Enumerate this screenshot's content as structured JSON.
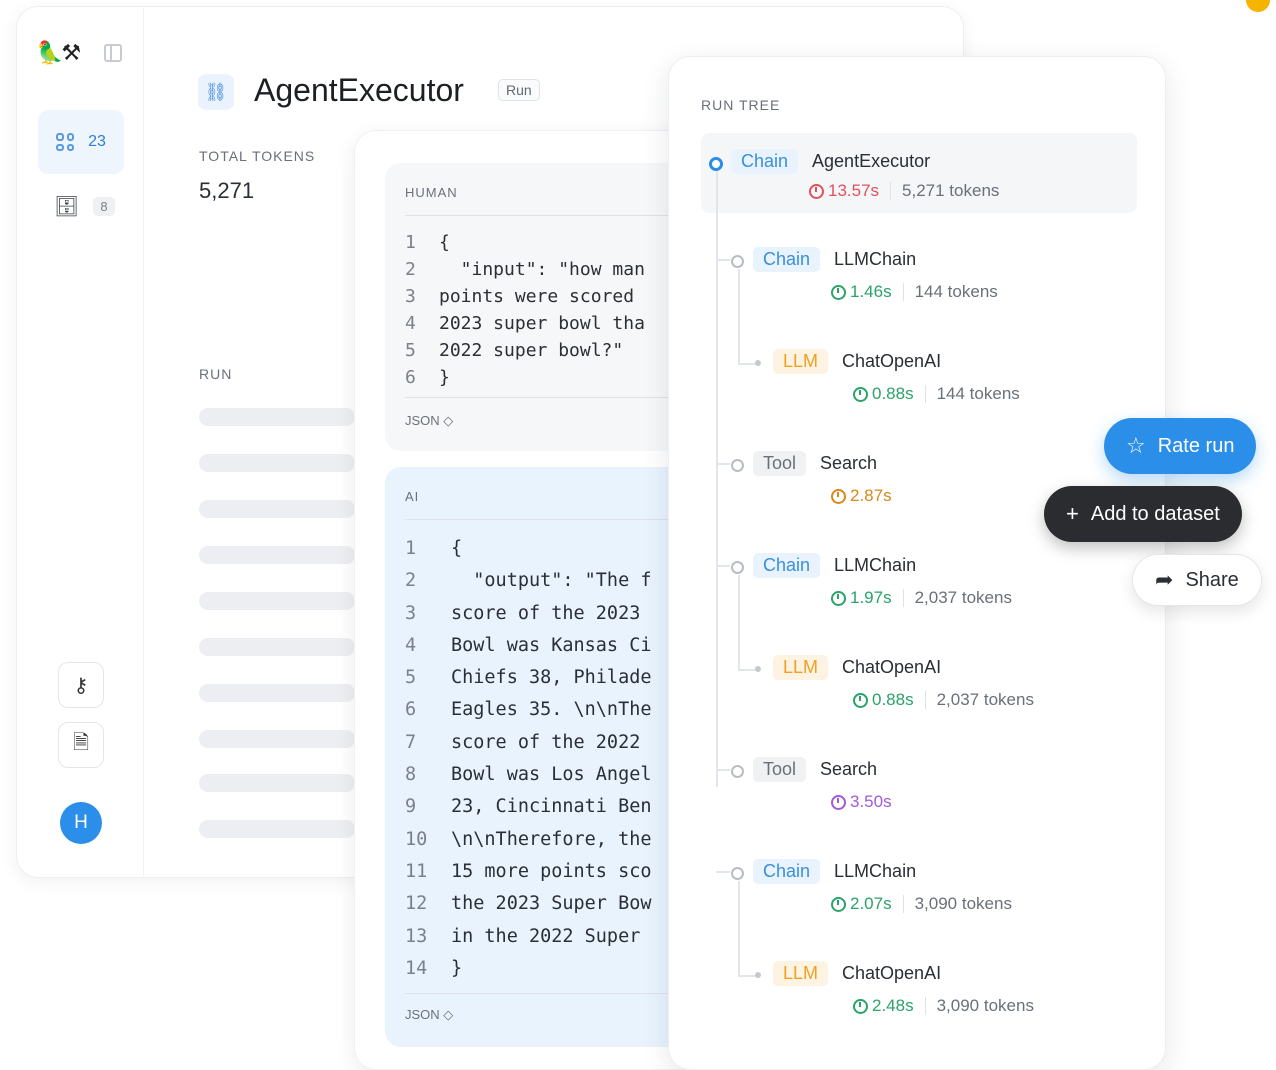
{
  "colors": {
    "accent": "#2b8ee8",
    "chain_tag": "#3a8fdc",
    "llm_tag": "#f0a01e",
    "time_red": "#e0525b",
    "time_green": "#2aa368",
    "time_orange": "#d9881a",
    "time_purple": "#a15ad8"
  },
  "sidebar": {
    "logo": "🦜⚒",
    "nav_active_count": "23",
    "nav_db_count": "8",
    "avatar_initial": "H",
    "icons": [
      "grid-icon",
      "database-icon",
      "key-icon",
      "document-icon",
      "panel-toggle-icon"
    ]
  },
  "header": {
    "title": "AgentExecutor",
    "badge": "Run"
  },
  "summary": {
    "total_tokens_label": "TOTAL TOKENS",
    "total_tokens_value": "5,271",
    "run_label": "RUN"
  },
  "human": {
    "label": "HUMAN",
    "lines": [
      {
        "n": "1",
        "text": "{"
      },
      {
        "n": "2",
        "text": "  \"input\": \"how man"
      },
      {
        "n": "3",
        "text": "points were scored"
      },
      {
        "n": "4",
        "text": "2023 super bowl tha"
      },
      {
        "n": "5",
        "text": "2022 super bowl?\""
      },
      {
        "n": "6",
        "text": "}"
      }
    ],
    "format": "JSON ◇"
  },
  "ai": {
    "label": "AI",
    "lines": [
      {
        "n": "1",
        "text": "{"
      },
      {
        "n": "2",
        "text": "  \"output\": \"The f"
      },
      {
        "n": "3",
        "text": "score of the 2023"
      },
      {
        "n": "4",
        "text": "Bowl was Kansas Ci"
      },
      {
        "n": "5",
        "text": "Chiefs 38, Philade"
      },
      {
        "n": "6",
        "text": "Eagles 35. \\n\\nThe"
      },
      {
        "n": "7",
        "text": "score of the 2022"
      },
      {
        "n": "8",
        "text": "Bowl was Los Angel"
      },
      {
        "n": "9",
        "text": "23, Cincinnati Ben"
      },
      {
        "n": "10",
        "text": "\\n\\nTherefore, the"
      },
      {
        "n": "11",
        "text": "15 more points sco"
      },
      {
        "n": "12",
        "text": "the 2023 Super Bow"
      },
      {
        "n": "13",
        "text": "in the 2022 Super"
      },
      {
        "n": "14",
        "text": "}"
      }
    ],
    "format": "JSON ◇"
  },
  "run_tree": {
    "title": "RUN TREE",
    "nodes": [
      {
        "tag": "Chain",
        "kind": "chain",
        "name": "AgentExecutor",
        "time": "13.57s",
        "time_color": "#e0525b",
        "tokens": "5,271 tokens"
      },
      {
        "tag": "Chain",
        "kind": "chain",
        "name": "LLMChain",
        "time": "1.46s",
        "time_color": "#2aa368",
        "tokens": "144 tokens"
      },
      {
        "tag": "LLM",
        "kind": "llm",
        "name": "ChatOpenAI",
        "time": "0.88s",
        "time_color": "#2aa368",
        "tokens": "144 tokens"
      },
      {
        "tag": "Tool",
        "kind": "tool",
        "name": "Search",
        "time": "2.87s",
        "time_color": "#d9881a",
        "tokens": ""
      },
      {
        "tag": "Chain",
        "kind": "chain",
        "name": "LLMChain",
        "time": "1.97s",
        "time_color": "#2aa368",
        "tokens": "2,037 tokens"
      },
      {
        "tag": "LLM",
        "kind": "llm",
        "name": "ChatOpenAI",
        "time": "0.88s",
        "time_color": "#2aa368",
        "tokens": "2,037 tokens"
      },
      {
        "tag": "Tool",
        "kind": "tool",
        "name": "Search",
        "time": "3.50s",
        "time_color": "#a15ad8",
        "tokens": ""
      },
      {
        "tag": "Chain",
        "kind": "chain",
        "name": "LLMChain",
        "time": "2.07s",
        "time_color": "#2aa368",
        "tokens": "3,090 tokens"
      },
      {
        "tag": "LLM",
        "kind": "llm",
        "name": "ChatOpenAI",
        "time": "2.48s",
        "time_color": "#2aa368",
        "tokens": "3,090 tokens"
      }
    ]
  },
  "actions": {
    "rate_label": "Rate run",
    "add_label": "Add to dataset",
    "share_label": "Share"
  }
}
